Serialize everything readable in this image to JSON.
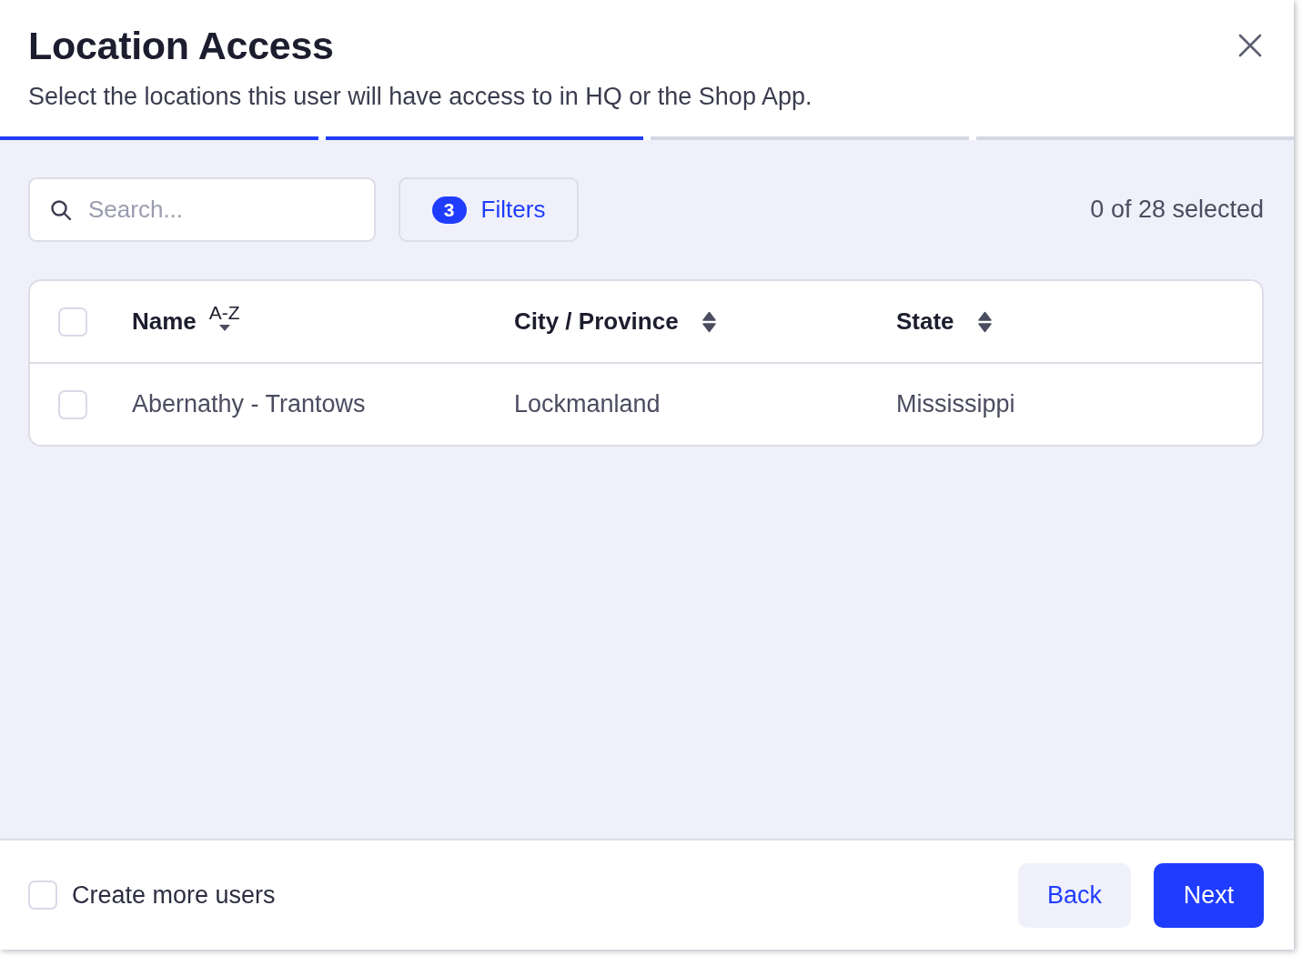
{
  "dialog": {
    "title": "Location Access",
    "subtitle": "Select the locations this user will have access to in HQ or the Shop App."
  },
  "steps": [
    {
      "done": true
    },
    {
      "done": true
    },
    {
      "done": false
    },
    {
      "done": false
    }
  ],
  "toolbar": {
    "search": {
      "placeholder": "Search..."
    },
    "filters_button": {
      "count": "3",
      "label": "Filters"
    },
    "selection_count": "0 of 28 selected"
  },
  "table": {
    "header_checked": false,
    "columns": [
      {
        "label": "Name",
        "sorted": true,
        "sort_label": "A-Z"
      },
      {
        "label": "City / Province",
        "sorted": false
      },
      {
        "label": "State",
        "sorted": false
      }
    ],
    "rows": [
      {
        "checked": false,
        "cells": [
          "Abernathy - Trantows",
          "Lockmanland",
          "Mississippi"
        ]
      }
    ]
  },
  "footer": {
    "create_more": {
      "label": "Create more users",
      "checked": false
    },
    "buttons": [
      {
        "label": "Back",
        "kind": "secondary"
      },
      {
        "label": "Next",
        "kind": "primary"
      }
    ]
  }
}
